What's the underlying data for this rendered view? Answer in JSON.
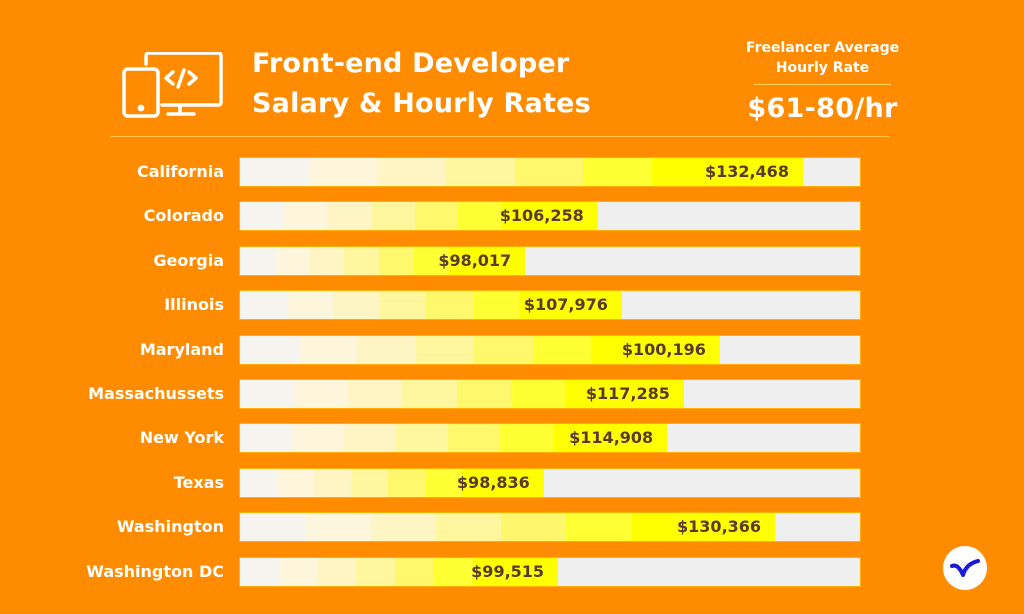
{
  "header": {
    "title_line1": "Front-end Developer",
    "title_line2": "Salary & Hourly Rates",
    "icon": "devices-code-icon"
  },
  "rate": {
    "label_line1": "Freelancer Average",
    "label_line2": "Hourly Rate",
    "value": "$61-80/hr"
  },
  "colors": {
    "background": "#ff8c00",
    "track": "#efefef",
    "segments": [
      "#f6f4ef",
      "#fdf6dc",
      "#fff4c4",
      "#fff69e",
      "#fff86c",
      "#ffff33",
      "#ffff00"
    ],
    "value_text": "#5a3a2a",
    "logo_mark": "#1a1ad6"
  },
  "logo": {
    "icon": "bird-logo-icon"
  },
  "chart_data": {
    "type": "bar",
    "orientation": "horizontal",
    "title": "Front-end Developer Salary & Hourly Rates",
    "xlabel": "",
    "ylabel": "",
    "grid": false,
    "legend": "none",
    "categories": [
      "California",
      "Colorado",
      "Georgia",
      "Illinois",
      "Maryland",
      "Massachussets",
      "New York",
      "Texas",
      "Washington",
      "Washington DC"
    ],
    "values": [
      132468,
      106258,
      98017,
      107976,
      100196,
      117285,
      114908,
      98836,
      130366,
      99515
    ],
    "value_labels": [
      "$132,468",
      "$106,258",
      "$98,017",
      "$107,976",
      "$100,196",
      "$117,285",
      "$114,908",
      "$98,836",
      "$130,366",
      "$99,515"
    ],
    "fill_fractions": [
      0.908,
      0.577,
      0.46,
      0.616,
      0.774,
      0.716,
      0.689,
      0.49,
      0.863,
      0.513
    ]
  }
}
